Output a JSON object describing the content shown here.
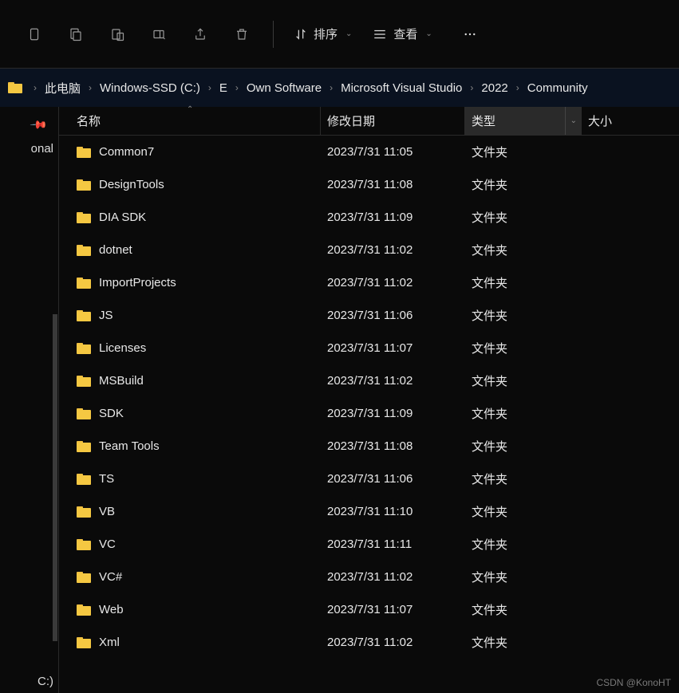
{
  "toolbar": {
    "sort_label": "排序",
    "view_label": "查看"
  },
  "breadcrumb": {
    "items": [
      "此电脑",
      "Windows-SSD (C:)",
      "E",
      "Own Software",
      "Microsoft Visual Studio",
      "2022",
      "Community"
    ]
  },
  "sidebar": {
    "label_partial": "onal",
    "bottom_partial": "C:)"
  },
  "columns": {
    "name": "名称",
    "date": "修改日期",
    "type": "类型",
    "size": "大小"
  },
  "rows": [
    {
      "name": "Common7",
      "date": "2023/7/31 11:05",
      "type": "文件夹"
    },
    {
      "name": "DesignTools",
      "date": "2023/7/31 11:08",
      "type": "文件夹"
    },
    {
      "name": "DIA SDK",
      "date": "2023/7/31 11:09",
      "type": "文件夹"
    },
    {
      "name": "dotnet",
      "date": "2023/7/31 11:02",
      "type": "文件夹"
    },
    {
      "name": "ImportProjects",
      "date": "2023/7/31 11:02",
      "type": "文件夹"
    },
    {
      "name": "JS",
      "date": "2023/7/31 11:06",
      "type": "文件夹"
    },
    {
      "name": "Licenses",
      "date": "2023/7/31 11:07",
      "type": "文件夹"
    },
    {
      "name": "MSBuild",
      "date": "2023/7/31 11:02",
      "type": "文件夹"
    },
    {
      "name": "SDK",
      "date": "2023/7/31 11:09",
      "type": "文件夹"
    },
    {
      "name": "Team Tools",
      "date": "2023/7/31 11:08",
      "type": "文件夹"
    },
    {
      "name": "TS",
      "date": "2023/7/31 11:06",
      "type": "文件夹"
    },
    {
      "name": "VB",
      "date": "2023/7/31 11:10",
      "type": "文件夹"
    },
    {
      "name": "VC",
      "date": "2023/7/31 11:11",
      "type": "文件夹"
    },
    {
      "name": "VC#",
      "date": "2023/7/31 11:02",
      "type": "文件夹"
    },
    {
      "name": "Web",
      "date": "2023/7/31 11:07",
      "type": "文件夹"
    },
    {
      "name": "Xml",
      "date": "2023/7/31 11:02",
      "type": "文件夹"
    }
  ],
  "watermark": "CSDN @KonoHT"
}
